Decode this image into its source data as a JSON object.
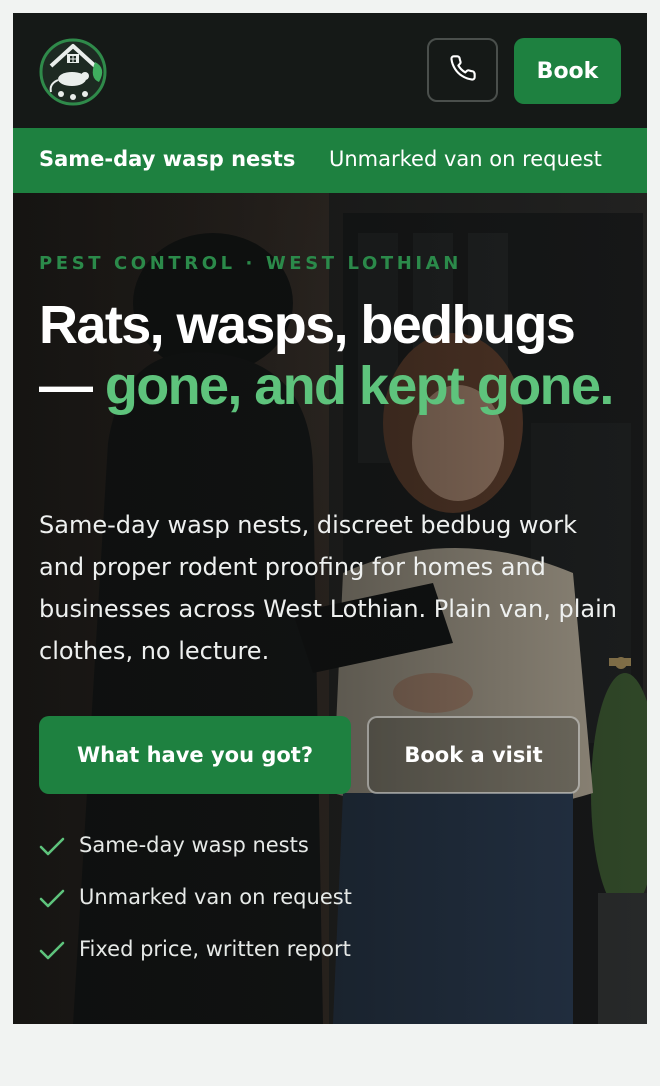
{
  "header": {
    "logo_icon": "house-rat-leaf-logo-icon",
    "phone_icon": "phone-icon",
    "book_label": "Book"
  },
  "ticker": {
    "items": [
      "Same-day wasp nests",
      "Unmarked van on request"
    ]
  },
  "hero": {
    "eyebrow": "PEST CONTROL · WEST LOTHIAN",
    "headline_plain": "Rats, wasps, bedbugs — ",
    "headline_accent": "gone, and kept gone.",
    "lede": "Same-day wasp nests, discreet bedbug work and proper rodent proofing for homes and businesses across West Lothian. Plain van, plain clothes, no lecture.",
    "primary_cta": "What have you got?",
    "secondary_cta": "Book a visit",
    "checklist": [
      "Same-day wasp nests",
      "Unmarked van on request",
      "Fixed price, written report"
    ],
    "check_icon": "check-icon"
  },
  "colors": {
    "brand_green": "#1e8140",
    "accent_green": "#5ec37c",
    "header_bg": "#151917"
  }
}
